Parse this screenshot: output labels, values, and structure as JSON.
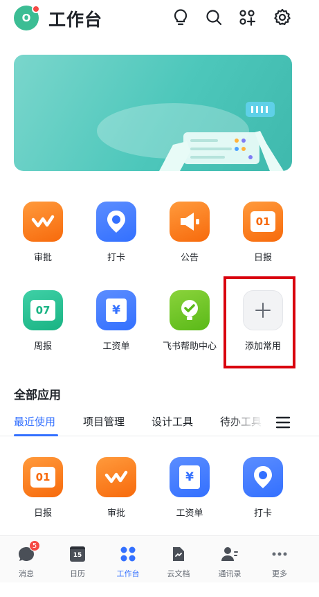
{
  "header": {
    "avatar_letter": "O",
    "title": "工作台",
    "icons": [
      "lightbulb-icon",
      "search-icon",
      "apps-add-icon",
      "settings-icon"
    ]
  },
  "common_apps": [
    {
      "label": "审批",
      "icon": "approval-icon",
      "color": "#f76a0c"
    },
    {
      "label": "打卡",
      "icon": "checkin-icon",
      "color": "#3370ff"
    },
    {
      "label": "公告",
      "icon": "announcement-icon",
      "color": "#f76a0c"
    },
    {
      "label": "日报",
      "icon": "daily-report-icon",
      "color": "#f76a0c",
      "icon_text": "01"
    },
    {
      "label": "周报",
      "icon": "weekly-report-icon",
      "color": "#19b383",
      "icon_text": "07"
    },
    {
      "label": "工资单",
      "icon": "payslip-icon",
      "color": "#3370ff",
      "icon_text": "¥"
    },
    {
      "label": "飞书帮助中心",
      "icon": "help-center-icon",
      "color": "#5ab918"
    },
    {
      "label": "添加常用",
      "icon": "add-icon",
      "color": "#f2f3f5",
      "highlighted": true
    }
  ],
  "all_apps": {
    "title": "全部应用",
    "tabs": [
      "最近使用",
      "项目管理",
      "设计工具",
      "待办工具"
    ],
    "active_tab": 0,
    "recent": [
      {
        "label": "日报",
        "icon": "daily-report-icon",
        "icon_text": "01"
      },
      {
        "label": "审批",
        "icon": "approval-icon"
      },
      {
        "label": "工资单",
        "icon": "payslip-icon",
        "icon_text": "¥"
      },
      {
        "label": "打卡",
        "icon": "checkin-icon"
      }
    ]
  },
  "bottom_nav": [
    {
      "label": "消息",
      "icon": "message-icon",
      "badge": "5"
    },
    {
      "label": "日历",
      "icon": "calendar-icon",
      "icon_text": "15"
    },
    {
      "label": "工作台",
      "icon": "workplace-icon",
      "active": true
    },
    {
      "label": "云文档",
      "icon": "docs-icon"
    },
    {
      "label": "通讯录",
      "icon": "contacts-icon"
    },
    {
      "label": "更多",
      "icon": "more-icon"
    }
  ],
  "colors": {
    "accent": "#3370ff",
    "highlight_border": "#d9000d",
    "banner": "#4dc7bb"
  }
}
